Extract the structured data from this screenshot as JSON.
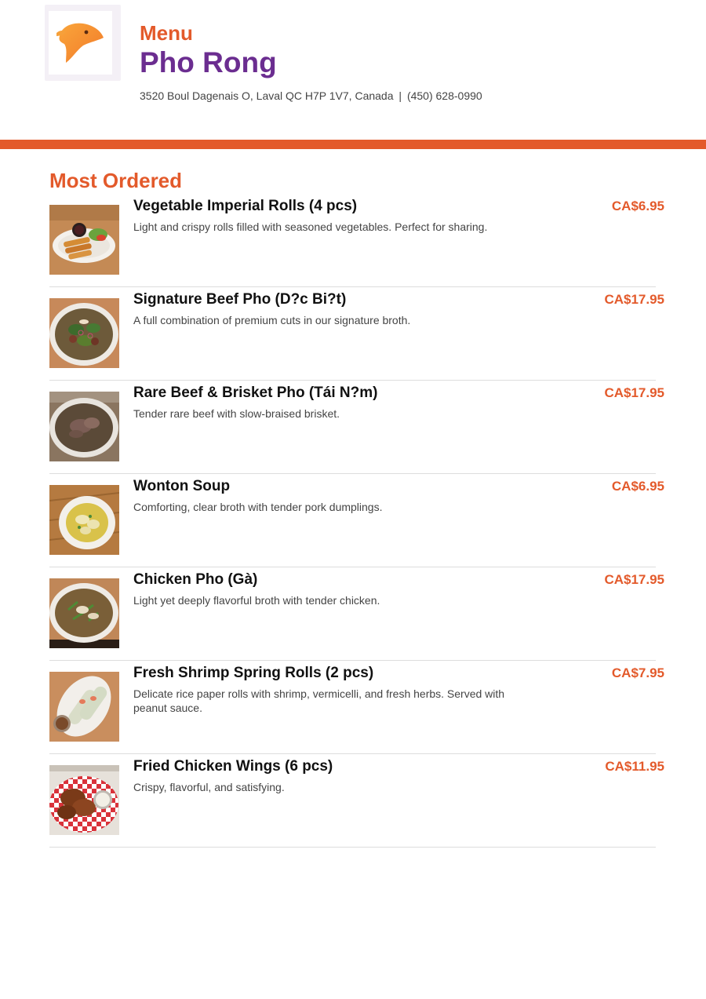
{
  "header": {
    "menu_label": "Menu",
    "restaurant_name": "Pho Rong",
    "address": "3520 Boul Dagenais O, Laval QC H7P 1V7, Canada",
    "separator": "|",
    "phone": "(450) 628-0990",
    "logo_icon": "bird-head-logo-icon"
  },
  "colors": {
    "accent": "#e35a2b",
    "brand_purple": "#6b2d90"
  },
  "section": {
    "title": "Most Ordered"
  },
  "items": [
    {
      "name": "Vegetable Imperial Rolls (4 pcs)",
      "description": "Light and crispy rolls filled with seasoned vegetables. Perfect for sharing.",
      "price": "CA$6.95",
      "image_icon": "imperial-rolls-photo"
    },
    {
      "name": "Signature Beef Pho (D?c Bi?t)",
      "description": "A full combination of premium cuts in our signature broth.",
      "price": "CA$17.95",
      "image_icon": "beef-pho-photo"
    },
    {
      "name": "Rare Beef & Brisket Pho (Tái N?m)",
      "description": "Tender rare beef with slow-braised brisket.",
      "price": "CA$17.95",
      "image_icon": "rare-beef-pho-photo"
    },
    {
      "name": "Wonton Soup",
      "description": "Comforting, clear broth with tender pork dumplings.",
      "price": "CA$6.95",
      "image_icon": "wonton-soup-photo"
    },
    {
      "name": "Chicken Pho (Gà)",
      "description": "Light yet deeply flavorful broth with tender chicken.",
      "price": "CA$17.95",
      "image_icon": "chicken-pho-photo"
    },
    {
      "name": "Fresh Shrimp Spring Rolls (2 pcs)",
      "description": "Delicate rice paper rolls with shrimp, vermicelli, and fresh herbs. Served with peanut sauce.",
      "price": "CA$7.95",
      "image_icon": "spring-rolls-photo"
    },
    {
      "name": "Fried Chicken Wings (6 pcs)",
      "description": "Crispy, flavorful, and satisfying.",
      "price": "CA$11.95",
      "image_icon": "chicken-wings-photo"
    }
  ]
}
